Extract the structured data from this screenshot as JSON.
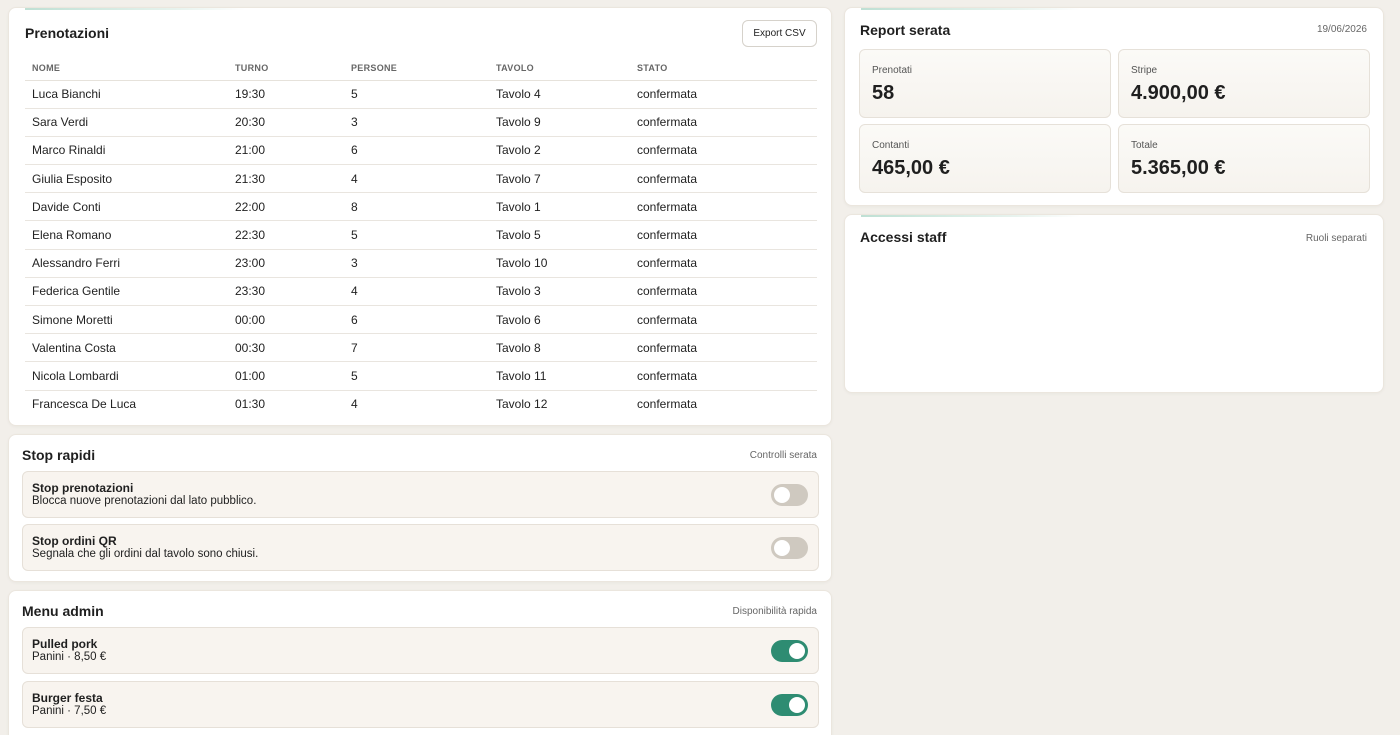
{
  "reservations": {
    "title": "Prenotazioni",
    "export_label": "Export CSV",
    "columns": [
      "NOME",
      "TURNO",
      "PERSONE",
      "TAVOLO",
      "STATO"
    ],
    "rows": [
      [
        "Luca Bianchi",
        "19:30",
        "5",
        "Tavolo 4",
        "confermata"
      ],
      [
        "Sara Verdi",
        "20:30",
        "3",
        "Tavolo 9",
        "confermata"
      ],
      [
        "Marco Rinaldi",
        "21:00",
        "6",
        "Tavolo 2",
        "confermata"
      ],
      [
        "Giulia Esposito",
        "21:30",
        "4",
        "Tavolo 7",
        "confermata"
      ],
      [
        "Davide Conti",
        "22:00",
        "8",
        "Tavolo 1",
        "confermata"
      ],
      [
        "Elena Romano",
        "22:30",
        "5",
        "Tavolo 5",
        "confermata"
      ],
      [
        "Alessandro Ferri",
        "23:00",
        "3",
        "Tavolo 10",
        "confermata"
      ],
      [
        "Federica Gentile",
        "23:30",
        "4",
        "Tavolo 3",
        "confermata"
      ],
      [
        "Simone Moretti",
        "00:00",
        "6",
        "Tavolo 6",
        "confermata"
      ],
      [
        "Valentina Costa",
        "00:30",
        "7",
        "Tavolo 8",
        "confermata"
      ],
      [
        "Nicola Lombardi",
        "01:00",
        "5",
        "Tavolo 11",
        "confermata"
      ],
      [
        "Francesca De Luca",
        "01:30",
        "4",
        "Tavolo 12",
        "confermata"
      ]
    ]
  },
  "stop": {
    "title": "Stop rapidi",
    "note": "Controlli serata",
    "items": [
      {
        "title": "Stop prenotazioni",
        "desc": "Blocca nuove prenotazioni dal lato pubblico.",
        "on": false
      },
      {
        "title": "Stop ordini QR",
        "desc": "Segnala che gli ordini dal tavolo sono chiusi.",
        "on": false
      }
    ]
  },
  "menu": {
    "title": "Menu admin",
    "note": "Disponibilità rapida",
    "items": [
      {
        "title": "Pulled pork",
        "desc": "Panini · 8,50 €",
        "on": true
      },
      {
        "title": "Burger festa",
        "desc": "Panini · 7,50 €",
        "on": true
      }
    ]
  },
  "report": {
    "title": "Report serata",
    "date": "19/06/2026",
    "stats": [
      {
        "label": "Prenotati",
        "value": "58"
      },
      {
        "label": "Stripe",
        "value": "4.900,00 €"
      },
      {
        "label": "Contanti",
        "value": "465,00 €"
      },
      {
        "label": "Totale",
        "value": "5.365,00 €"
      }
    ]
  },
  "staff": {
    "title": "Accessi staff",
    "note": "Ruoli separati"
  },
  "colors": {
    "accent_green": "#2e8c72",
    "page_background": "#f2efea"
  }
}
